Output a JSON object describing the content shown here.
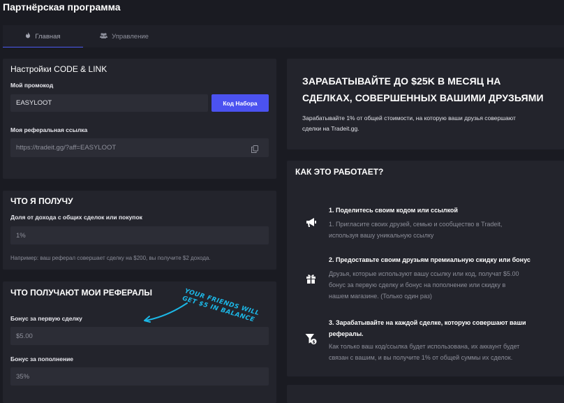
{
  "page": {
    "title": "Партнёрская программа"
  },
  "tabs": [
    {
      "label": "Главная",
      "icon": "flame-icon",
      "active": true
    },
    {
      "label": "Управление",
      "icon": "users-icon",
      "active": false
    }
  ],
  "settings": {
    "title": "Настройки CODE & LINK",
    "promo_label": "Мой промокод",
    "promo_value": "EASYLOOT",
    "promo_button": "Код Набора",
    "ref_label": "Моя реферальная ссылка",
    "ref_value": "https://tradeit.gg/?aff=EASYLOOT"
  },
  "earn": {
    "title": "ЧТО Я ПОЛУЧУ",
    "share_label": "Доля от дохода с общих сделок или покупок",
    "share_value": "1%",
    "example": "Например: ваш реферал совершает сделку на $200, вы получите $2 дохода."
  },
  "referrals": {
    "title": "ЧТО ПОЛУЧАЮТ МОИ РЕФЕРАЛЫ",
    "first_label": "Бонус за первую сделку",
    "first_value": "$5.00",
    "deposit_label": "Бонус за пополнение",
    "deposit_value": "35%",
    "callout_line1": "YOUR FRIENDS WILL",
    "callout_line2": "GET $5 IN BALANCE"
  },
  "promo": {
    "headline_line1": "ЗАРАБАТЫВАЙТЕ ДО $25K В МЕСЯЦ НА",
    "headline_line2": "СДЕЛКАХ, СОВЕРШЕННЫХ ВАШИМИ ДРУЗЬЯМИ",
    "desc_line1": "Зарабатывайте 1% от общей стоимости, на которую ваши друзья совершают",
    "desc_line2": "сделки на Tradeit.gg."
  },
  "how": {
    "title": "КАК ЭТО РАБОТАЕТ?",
    "steps": [
      {
        "icon": "megaphone-icon",
        "title": "1. Поделитесь своим кодом или ссылкой",
        "text": [
          "1. Пригласите своих друзей, семью и сообщество в Tradeit,",
          "используя вашу уникальную ссылку"
        ]
      },
      {
        "icon": "gift-icon",
        "title": "2. Предоставьте своим друзьям премиальную скидку или бонус",
        "text": [
          "Друзья, которые используют вашу ссылку или код, получат $5.00",
          "бонус за первую сделку и бонус на пополнение или скидку в",
          "нашем магазине. (Только один раз)"
        ]
      },
      {
        "icon": "funnel-dollar-icon",
        "title": [
          "3. Зарабатывайте на каждой сделке, которую совершают ваши",
          "рефералы."
        ],
        "text": [
          "Как только ваш код/ссылка будет использована, их аккаунт будет",
          "связан с вашим, и вы получите 1% от общей суммы их сделок."
        ]
      }
    ]
  },
  "colors": {
    "accent": "#4b52f0",
    "callout": "#1cb7e6",
    "panel": "#23242c",
    "field": "#2c2d36",
    "background": "#1a1b22"
  }
}
